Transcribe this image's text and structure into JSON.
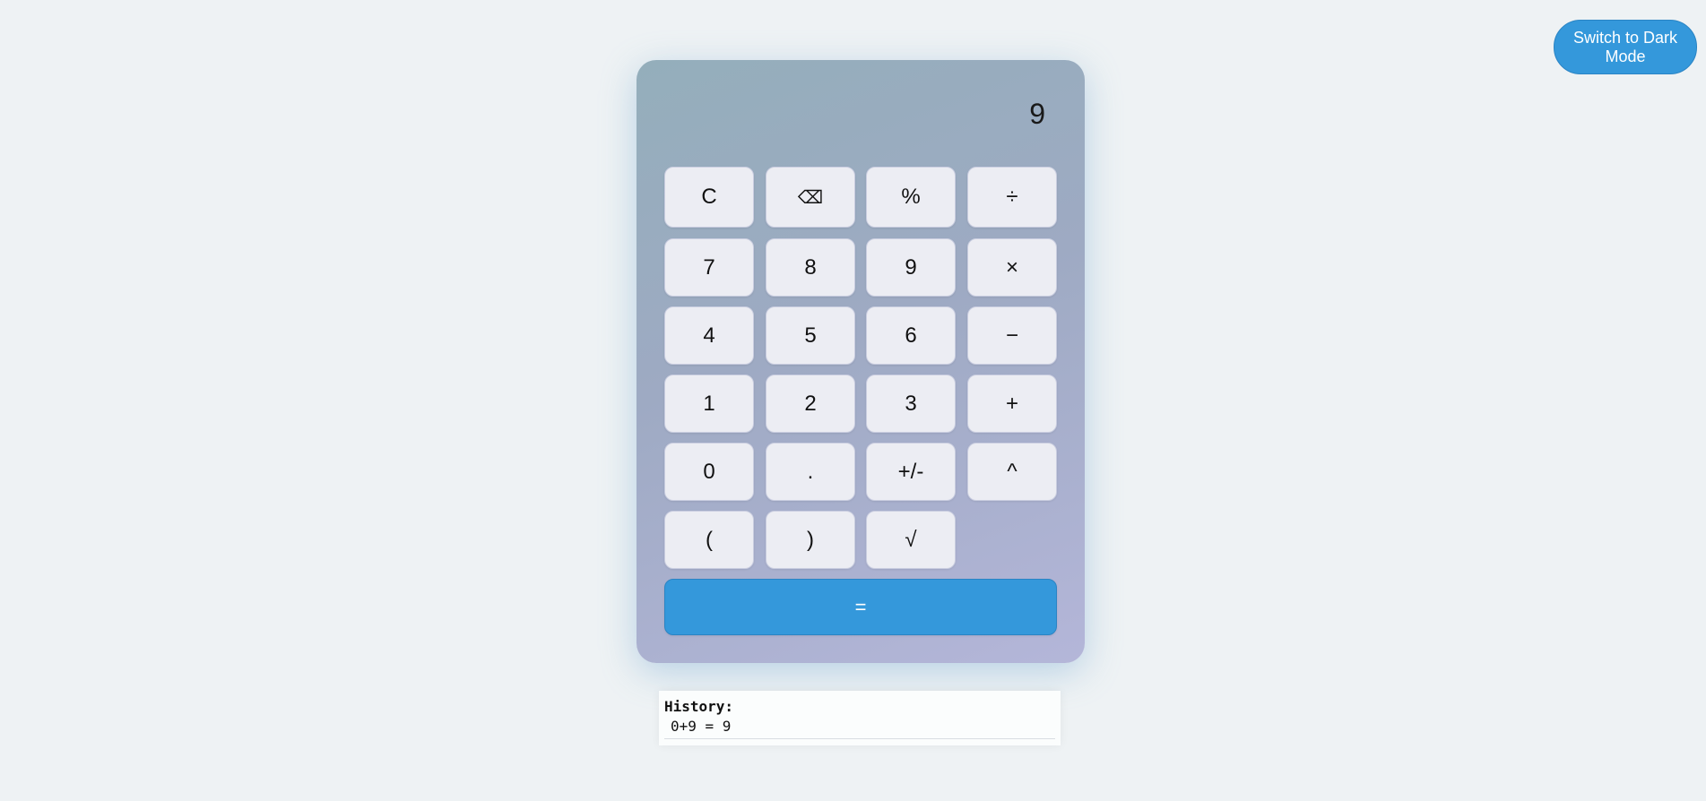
{
  "theme_toggle": {
    "label": "Switch to Dark Mode"
  },
  "display": {
    "value": "9"
  },
  "keys": [
    [
      "C",
      "⌫",
      "%",
      "÷"
    ],
    [
      "7",
      "8",
      "9",
      "×"
    ],
    [
      "4",
      "5",
      "6",
      "−"
    ],
    [
      "1",
      "2",
      "3",
      "+"
    ],
    [
      "0",
      ".",
      "+/-",
      "^"
    ],
    [
      "(",
      ")",
      "√"
    ]
  ],
  "equals_label": "=",
  "history": {
    "title": "History:",
    "items": [
      "0+9 = 9"
    ]
  },
  "colors": {
    "accent": "#3498db",
    "background": "#eef2f4",
    "key_bg": "#ecedf3"
  }
}
